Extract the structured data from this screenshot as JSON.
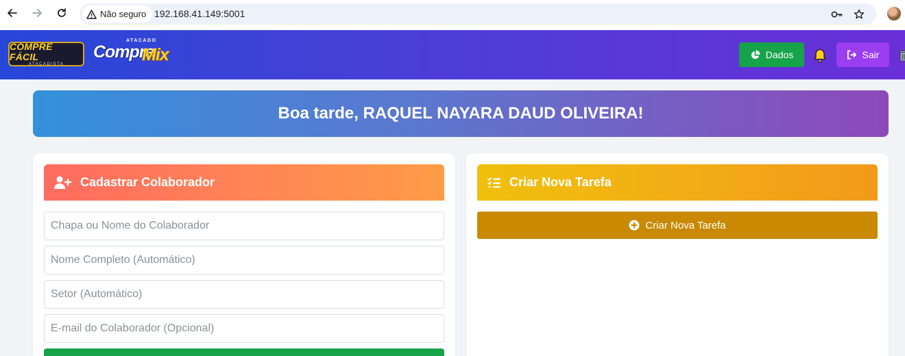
{
  "browser": {
    "security_label": "Não seguro",
    "url": "192.168.41.149:5001"
  },
  "header": {
    "logo1_main": "COMPRE FÁCIL",
    "logo1_sub": "ATACADISTA",
    "logo2_top": "ATACADO",
    "logo2_compre": "Compre",
    "logo2_mix": "Mix",
    "dados_label": "Dados",
    "sair_label": "Sair"
  },
  "greeting": "Boa tarde, RAQUEL NAYARA DAUD OLIVEIRA!",
  "cadastro": {
    "title": "Cadastrar Colaborador",
    "fields": {
      "chapa_placeholder": "Chapa ou Nome do Colaborador",
      "nome_placeholder": "Nome Completo (Automático)",
      "setor_placeholder": "Setor (Automático)",
      "email_placeholder": "E-mail do Colaborador (Opcional)"
    }
  },
  "tarefa": {
    "title": "Criar Nova Tarefa",
    "button_label": "Criar Nova Tarefa"
  },
  "colors": {
    "dados_green": "#16a34a",
    "sair_purple": "#9b3df0",
    "criar_button": "#c98902"
  }
}
